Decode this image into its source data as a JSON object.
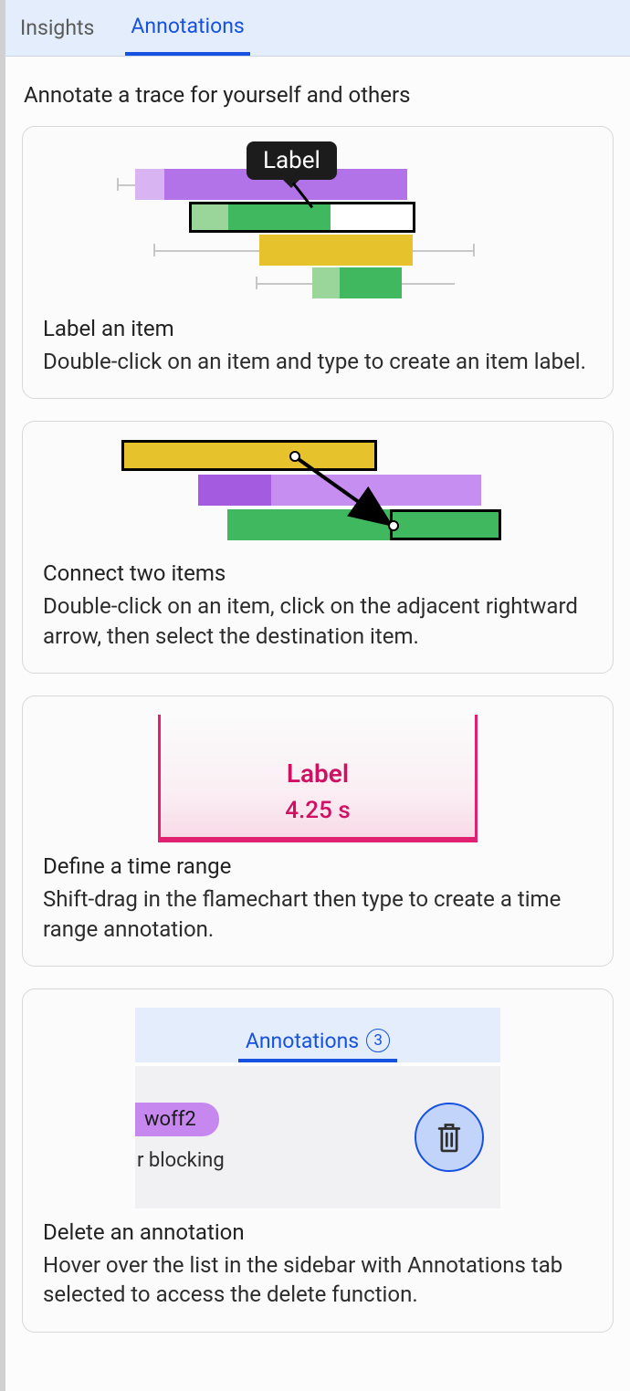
{
  "tabs": {
    "insights": "Insights",
    "annotations": "Annotations"
  },
  "title": "Annotate a trace for yourself and others",
  "cards": {
    "label_item": {
      "tooltip": "Label",
      "title": "Label an item",
      "desc": "Double-click on an item and type to create an item label."
    },
    "connect": {
      "title": "Connect two items",
      "desc": "Double-click on an item, click on the adjacent rightward arrow, then select the destination item."
    },
    "time_range": {
      "label": "Label",
      "duration": "4.25 s",
      "title": "Define a time range",
      "desc": "Shift-drag in the flamechart then type to create a time range annotation."
    },
    "delete": {
      "tab_label": "Annotations",
      "count": "3",
      "item_tag": "woff2",
      "item_text": "r blocking",
      "title": "Delete an annotation",
      "desc": "Hover over the list in the sidebar with Annotations tab selected to access the delete function."
    }
  }
}
